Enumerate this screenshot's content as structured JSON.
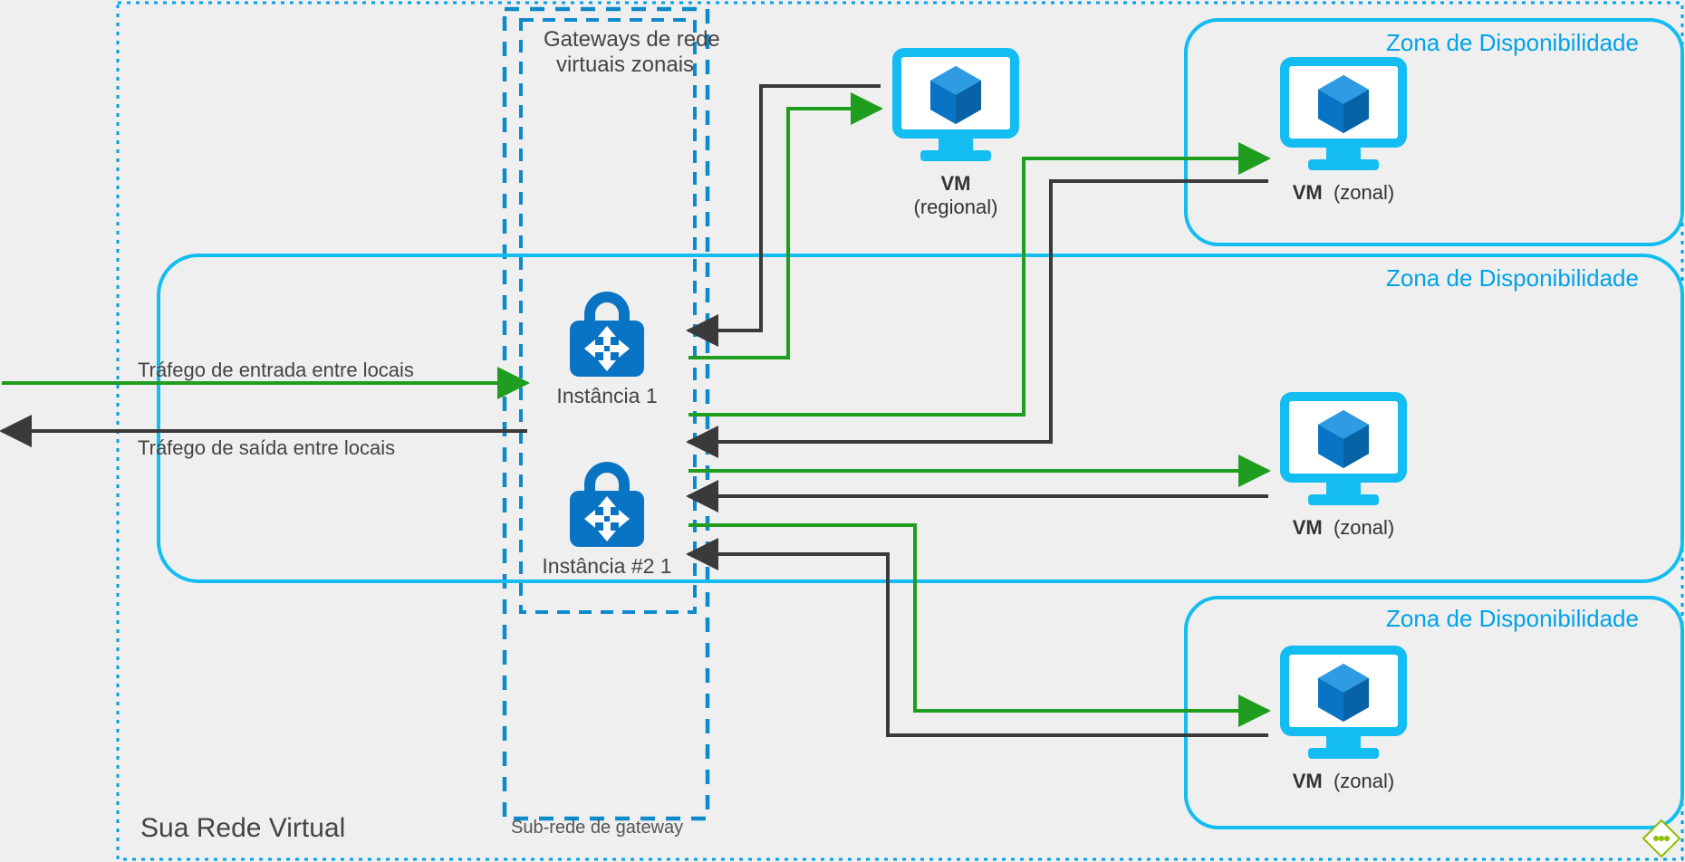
{
  "vnet_title": "Sua Rede Virtual",
  "gateway_subnet_label": "Sub-rede de gateway",
  "gateway_group_line1": "Gateways de rede",
  "gateway_group_line2": "virtuais zonais",
  "traffic_in_label": "Tráfego de entrada entre locais",
  "traffic_out_label": "Tráfego de saída entre locais",
  "instance1_label": "Instância 1",
  "instance2_label": "Instância #2 1",
  "vm_regional_bold": "VM",
  "vm_regional_paren": "(regional)",
  "vm_zonal_bold": "VM",
  "vm_zonal_paren": "(zonal)",
  "zone_label": "Zona de Disponibilidade",
  "resize_handle_title": "resize"
}
